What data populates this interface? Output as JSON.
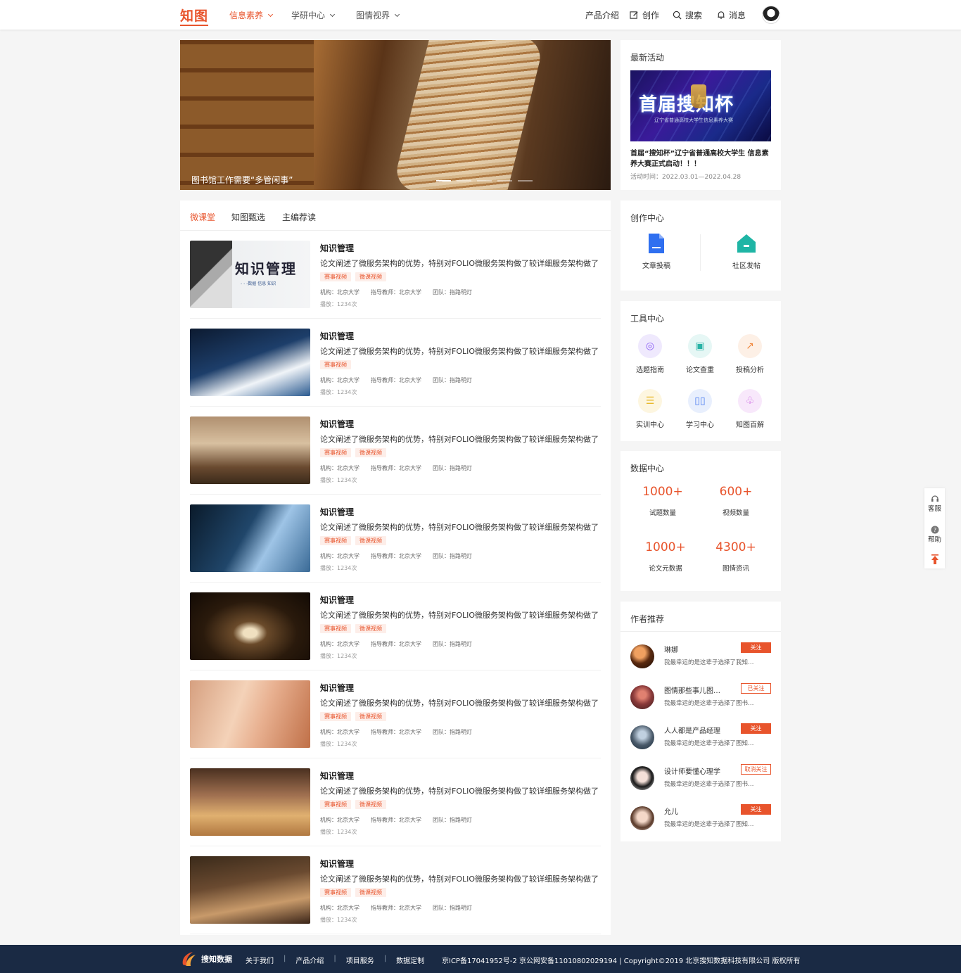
{
  "header": {
    "logo": "知图",
    "nav": [
      {
        "label": "信息素养",
        "active": true
      },
      {
        "label": "学研中心",
        "active": false
      },
      {
        "label": "图情视界",
        "active": false
      }
    ],
    "right": {
      "product": "产品介绍",
      "create": "创作",
      "search": "搜索",
      "message": "消息"
    }
  },
  "banner": {
    "caption": "图书馆工作需要“多管闲事”",
    "dots": 5,
    "active_dot": 0
  },
  "tabs": [
    "微课堂",
    "知图甄选",
    "主编荐读"
  ],
  "list": [
    {
      "title": "知识管理",
      "desc": "论文阐述了微服务架构的优势，特别对FOLIO微服务架构做了较详细服务架构做了较…",
      "tags": [
        "赛事视频",
        "微课视频"
      ],
      "org": "机构：北京大学",
      "teacher": "指导教师：北京大学",
      "team": "团队：指路明灯",
      "play": "播放：1234次"
    },
    {
      "title": "知识管理",
      "desc": "论文阐述了微服务架构的优势，特别对FOLIO微服务架构做了较详细服务架构做了较…",
      "tags": [
        "赛事视频"
      ],
      "org": "机构：北京大学",
      "teacher": "指导教师：北京大学",
      "team": "团队：指路明灯",
      "play": "播放：1234次"
    },
    {
      "title": "知识管理",
      "desc": "论文阐述了微服务架构的优势，特别对FOLIO微服务架构做了较详细服务架构做了较…",
      "tags": [
        "赛事视频",
        "微课视频"
      ],
      "org": "机构：北京大学",
      "teacher": "指导教师：北京大学",
      "team": "团队：指路明灯",
      "play": "播放：1234次"
    },
    {
      "title": "知识管理",
      "desc": "论文阐述了微服务架构的优势，特别对FOLIO微服务架构做了较详细服务架构做了较…",
      "tags": [
        "赛事视频",
        "微课视频"
      ],
      "org": "机构：北京大学",
      "teacher": "指导教师：北京大学",
      "team": "团队：指路明灯",
      "play": "播放：1234次"
    },
    {
      "title": "知识管理",
      "desc": "论文阐述了微服务架构的优势，特别对FOLIO微服务架构做了较详细服务架构做了较…",
      "tags": [
        "赛事视频",
        "微课视频"
      ],
      "org": "机构：北京大学",
      "teacher": "指导教师：北京大学",
      "team": "团队：指路明灯",
      "play": "播放：1234次"
    },
    {
      "title": "知识管理",
      "desc": "论文阐述了微服务架构的优势，特别对FOLIO微服务架构做了较详细服务架构做了较…",
      "tags": [
        "赛事视频",
        "微课视频"
      ],
      "org": "机构：北京大学",
      "teacher": "指导教师：北京大学",
      "team": "团队：指路明灯",
      "play": "播放：1234次"
    },
    {
      "title": "知识管理",
      "desc": "论文阐述了微服务架构的优势，特别对FOLIO微服务架构做了较详细服务架构做了较…",
      "tags": [
        "赛事视频",
        "微课视频"
      ],
      "org": "机构：北京大学",
      "teacher": "指导教师：北京大学",
      "team": "团队：指路明灯",
      "play": "播放：1234次"
    },
    {
      "title": "知识管理",
      "desc": "论文阐述了微服务架构的优势，特别对FOLIO微服务架构做了较详细服务架构做了较…",
      "tags": [
        "赛事视频",
        "微课视频"
      ],
      "org": "机构：北京大学",
      "teacher": "指导教师：北京大学",
      "team": "团队：指路明灯",
      "play": "播放：1234次"
    }
  ],
  "thumb1_text": {
    "main": "知识管理",
    "sub": "- - -数据 信息 知识"
  },
  "activity": {
    "title": "最新活动",
    "poster_text": "首届搜知杯",
    "poster_sub": "辽宁省普通高校大学生信息素养大赛",
    "headline": "首届“搜知杯”辽宁省普通高校大学生 信息素养大赛正式启动！！！",
    "time": "活动时间：2022.03.01—2022.04.28"
  },
  "creation": {
    "title": "创作中心",
    "items": [
      {
        "label": "文章投稿",
        "icon": "document-icon"
      },
      {
        "label": "社区发帖",
        "icon": "home-icon"
      }
    ]
  },
  "tools": {
    "title": "工具中心",
    "items": [
      {
        "label": "选题指南",
        "icon": "compass-icon",
        "color": "#8a5cf6",
        "bg": "#efe9fd"
      },
      {
        "label": "论文查重",
        "icon": "scan-icon",
        "color": "#2ab3a6",
        "bg": "#e6f7f5"
      },
      {
        "label": "投稿分析",
        "icon": "chart-icon",
        "color": "#f0883e",
        "bg": "#fdf0e6"
      },
      {
        "label": "实训中心",
        "icon": "list-icon",
        "color": "#e8b92c",
        "bg": "#fdf6e0"
      },
      {
        "label": "学习中心",
        "icon": "book-icon",
        "color": "#4a7cf0",
        "bg": "#e8effd"
      },
      {
        "label": "知图百解",
        "icon": "brain-icon",
        "color": "#c95ce0",
        "bg": "#f8e8fb"
      }
    ]
  },
  "datacenter": {
    "title": "数据中心",
    "items": [
      {
        "num": "1000+",
        "label": "试题数量"
      },
      {
        "num": "600+",
        "label": "视频数量"
      },
      {
        "num": "1000+",
        "label": "论文元数据"
      },
      {
        "num": "4300+",
        "label": "图情资讯"
      }
    ]
  },
  "authors": {
    "title": "作者推荐",
    "items": [
      {
        "name": "琳娜",
        "desc": "我最幸运的是这辈子选择了我知…",
        "btn": "关注",
        "filled": true
      },
      {
        "name": "图情那些事儿图…",
        "desc": "我最幸运的是这辈子选择了图书…",
        "btn": "已关注",
        "filled": false
      },
      {
        "name": "人人都是产品经理",
        "desc": "我最幸运的是这辈子选择了图知…",
        "btn": "关注",
        "filled": true
      },
      {
        "name": "设计师要懂心理学",
        "desc": "我最幸运的是这辈子选择了图书…",
        "btn": "取消关注",
        "filled": false
      },
      {
        "name": "允儿",
        "desc": "我最幸运的是这辈子选择了图知…",
        "btn": "关注",
        "filled": true
      }
    ]
  },
  "sidebar": {
    "service": "客服",
    "help": "帮助"
  },
  "footer": {
    "brand": "搜知数据",
    "links": [
      "关于我们",
      "产品介绍",
      "项目服务",
      "数据定制"
    ],
    "copyright": "京ICP备17041952号-2 京公网安备11010802029194 | Copyright©2019 北京搜知数据科技有限公司 版权所有"
  },
  "colors": {
    "accent": "#e8542c",
    "footer_bg": "#1a2a44"
  }
}
